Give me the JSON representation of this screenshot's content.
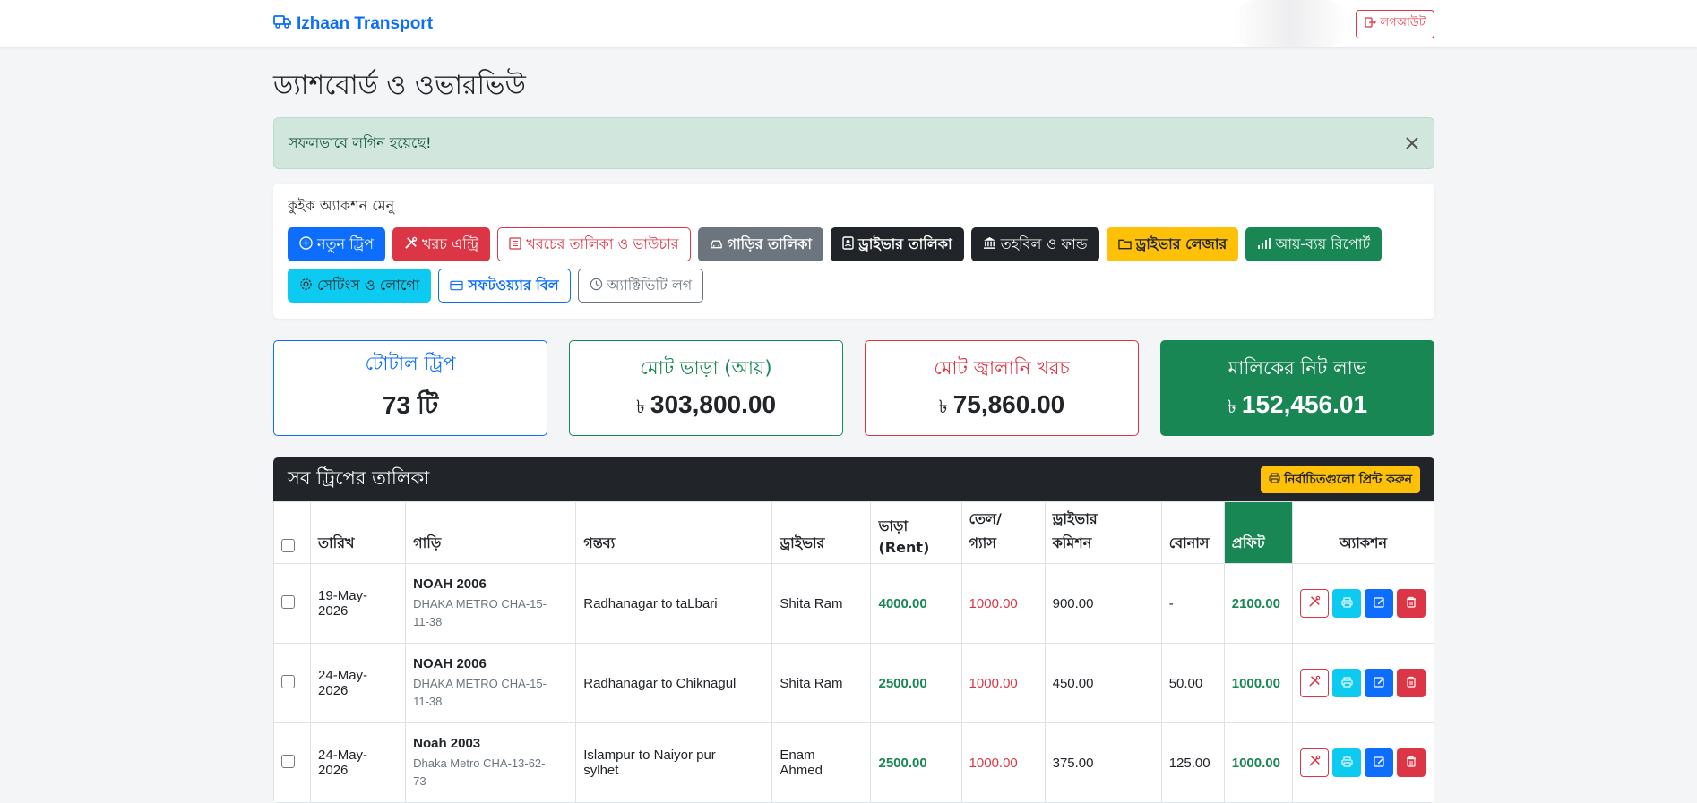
{
  "navbar": {
    "brand": "Izhaan Transport",
    "logout_label": "লগআউট"
  },
  "page": {
    "title": "ড্যাশবোর্ড ও ওভারভিউ"
  },
  "alert": {
    "message": "সফলভাবে লগিন হয়েছে!"
  },
  "quick_actions": {
    "title": "কুইক অ্যাকশন মেনু",
    "buttons": [
      {
        "label": "নতুন ট্রিপ",
        "icon": "plus-circle-icon"
      },
      {
        "label": "খরচ এন্ট্রি",
        "icon": "tools-icon"
      },
      {
        "label": "খরচের তালিকা ও ভাউচার",
        "icon": "list-icon"
      },
      {
        "label": "গাড়ির তালিকা",
        "icon": "car-icon"
      },
      {
        "label": "ড্রাইভার তালিকা",
        "icon": "id-card-icon"
      },
      {
        "label": "তহবিল ও ফান্ড",
        "icon": "bank-icon"
      },
      {
        "label": "ড্রাইভার লেজার",
        "icon": "folder-icon"
      },
      {
        "label": "আয়-ব্যয় রিপোর্ট",
        "icon": "bar-chart-icon"
      },
      {
        "label": "সেটিংস ও লোগো",
        "icon": "gear-icon"
      },
      {
        "label": "সফটওয়্যার বিল",
        "icon": "credit-card-icon"
      },
      {
        "label": "অ্যাক্টিভিটি লগ",
        "icon": "clock-icon"
      }
    ]
  },
  "stats": {
    "total_trips": {
      "label": "টোটাল ট্রিপ",
      "value": "73 টি"
    },
    "total_rent": {
      "label": "মোট ভাড়া (আয়)",
      "currency": "৳",
      "value": "303,800.00"
    },
    "fuel_cost": {
      "label": "মোট জ্বালানি খরচ",
      "currency": "৳",
      "value": "75,860.00"
    },
    "net_profit": {
      "label": "মালিকের নিট লাভ",
      "currency": "৳",
      "value": "152,456.01"
    }
  },
  "trips_table": {
    "title": "সব ট্রিপের তালিকা",
    "print_selected_label": "নির্বাচিতগুলো প্রিন্ট করুন",
    "headers": {
      "date": "তারিখ",
      "car": "গাড়ি",
      "destination": "গন্তব্য",
      "driver": "ড্রাইভার",
      "rent_1": "ভাড়া",
      "rent_2": "(Rent)",
      "fuel_1": "তেল/",
      "fuel_2": "গ্যাস",
      "commission_1": "ড্রাইভার",
      "commission_2": "কমিশন",
      "bonus": "বোনাস",
      "profit": "প্রফিট",
      "action": "অ্যাকশন"
    },
    "rows": [
      {
        "date_1": "19-May-",
        "date_2": "2026",
        "car_name": "NOAH 2006",
        "car_reg_1": "DHAKA METRO CHA-15-",
        "car_reg_2": "11-38",
        "destination_1": "Radhanagar to taLbari",
        "destination_2": "",
        "driver_1": "Shita Ram",
        "driver_2": "",
        "rent": "4000.00",
        "fuel": "1000.00",
        "commission": "900.00",
        "bonus": "-",
        "profit": "2100.00"
      },
      {
        "date_1": "24-May-",
        "date_2": "2026",
        "car_name": "NOAH 2006",
        "car_reg_1": "DHAKA METRO CHA-15-",
        "car_reg_2": "11-38",
        "destination_1": "Radhanagar to Chiknagul",
        "destination_2": "",
        "driver_1": "Shita Ram",
        "driver_2": "",
        "rent": "2500.00",
        "fuel": "1000.00",
        "commission": "450.00",
        "bonus": "50.00",
        "profit": "1000.00"
      },
      {
        "date_1": "24-May-",
        "date_2": "2026",
        "car_name": "Noah 2003",
        "car_reg_1": "Dhaka Metro CHA-13-62-",
        "car_reg_2": "73",
        "destination_1": "Islampur to Naiyor pur",
        "destination_2": "sylhet",
        "driver_1": "Enam",
        "driver_2": "Ahmed",
        "rent": "2500.00",
        "fuel": "1000.00",
        "commission": "375.00",
        "bonus": "125.00",
        "profit": "1000.00"
      }
    ]
  }
}
